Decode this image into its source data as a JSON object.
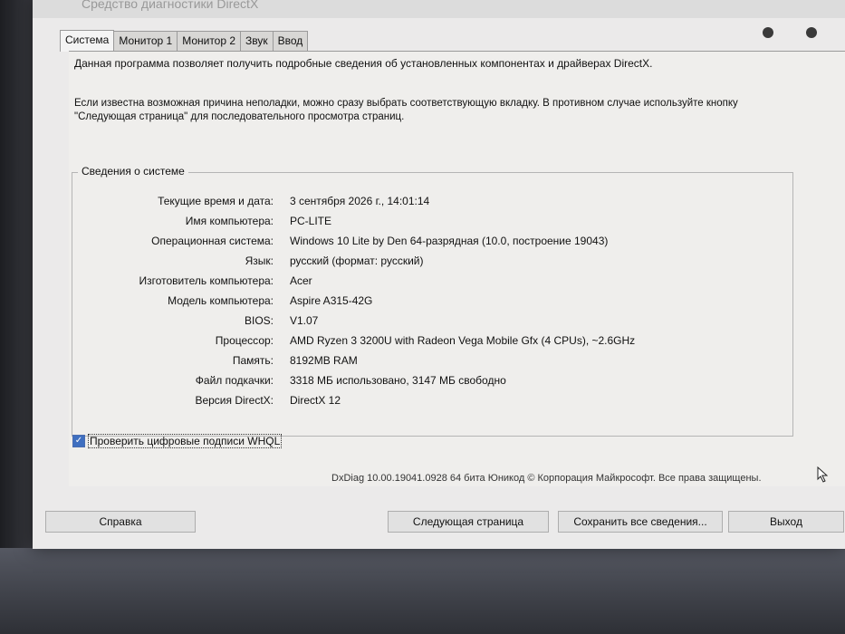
{
  "window": {
    "title": "Средство диагностики DirectX"
  },
  "tabs": [
    {
      "label": "Система",
      "active": true
    },
    {
      "label": "Монитор 1",
      "active": false
    },
    {
      "label": "Монитор 2",
      "active": false
    },
    {
      "label": "Звук",
      "active": false
    },
    {
      "label": "Ввод",
      "active": false
    }
  ],
  "intro": {
    "line1": "Данная программа позволяет получить подробные сведения об установленных компонентах и драйверах DirectX.",
    "line2": "Если известна возможная причина неполадки, можно сразу выбрать соответствующую вкладку. В противном случае используйте кнопку \"Следующая страница\" для последовательного просмотра страниц."
  },
  "system_info": {
    "group_title": "Сведения о системе",
    "rows": [
      {
        "label": "Текущие время и дата:",
        "value": "3 сентября 2026 г., 14:01:14"
      },
      {
        "label": "Имя компьютера:",
        "value": "PC-LITE"
      },
      {
        "label": "Операционная система:",
        "value": "Windows 10 Lite by Den 64-разрядная (10.0, построение 19043)"
      },
      {
        "label": "Язык:",
        "value": "русский (формат: русский)"
      },
      {
        "label": "Изготовитель компьютера:",
        "value": "Acer"
      },
      {
        "label": "Модель компьютера:",
        "value": "Aspire A315-42G"
      },
      {
        "label": "BIOS:",
        "value": "V1.07"
      },
      {
        "label": "Процессор:",
        "value": "AMD Ryzen 3 3200U with Radeon Vega Mobile Gfx   (4 CPUs), ~2.6GHz"
      },
      {
        "label": "Память:",
        "value": "8192MB RAM"
      },
      {
        "label": "Файл подкачки:",
        "value": "3318 МБ использовано, 3147 МБ свободно"
      },
      {
        "label": "Версия DirectX:",
        "value": "DirectX 12"
      }
    ]
  },
  "whql_checkbox": {
    "label": "Проверить цифровые подписи WHQL",
    "checked": true,
    "checkmark": "✓"
  },
  "footer": {
    "text": "DxDiag 10.00.19041.0928 64 бита Юникод © Корпорация Майкрософт. Все права защищены."
  },
  "buttons": {
    "help": "Справка",
    "next_page": "Следующая страница",
    "save_all": "Сохранить все сведения...",
    "exit": "Выход"
  },
  "colors": {
    "window_bg": "#ebeaea",
    "checkbox_accent": "#3f6fc0"
  }
}
